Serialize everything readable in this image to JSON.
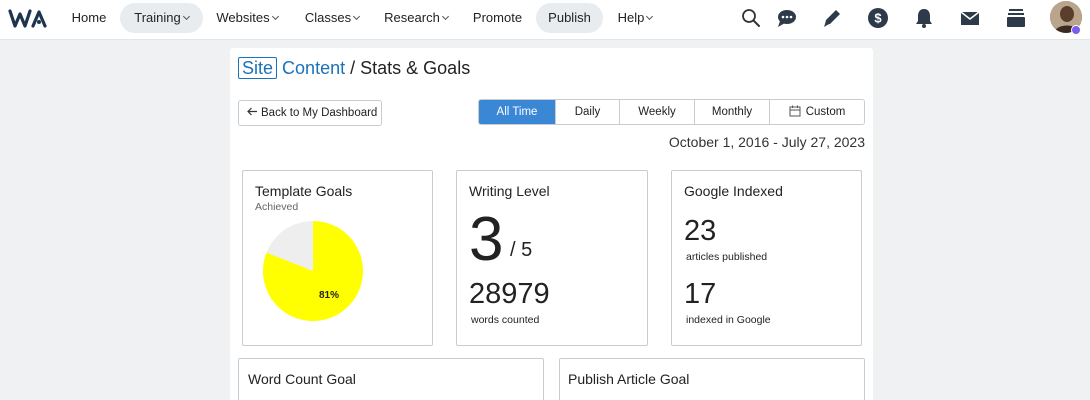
{
  "nav": {
    "items": [
      {
        "label": "Home",
        "dropdown": false,
        "active": false
      },
      {
        "label": "Training",
        "dropdown": true,
        "active": true
      },
      {
        "label": "Websites",
        "dropdown": true,
        "active": false
      },
      {
        "label": "Classes",
        "dropdown": true,
        "active": false
      },
      {
        "label": "Research",
        "dropdown": true,
        "active": false
      },
      {
        "label": "Promote",
        "dropdown": false,
        "active": false
      },
      {
        "label": "Publish",
        "dropdown": false,
        "active": true
      },
      {
        "label": "Help",
        "dropdown": true,
        "active": false
      }
    ],
    "icons": [
      "search-icon",
      "chat-icon",
      "pencil-icon",
      "dollar-icon",
      "bell-icon",
      "mail-icon",
      "inbox-icon"
    ]
  },
  "breadcrumb": {
    "site": "Site",
    "content": "Content",
    "separator": "/",
    "current": "Stats & Goals"
  },
  "back_button": "Back to My Dashboard",
  "ranges": [
    "All Time",
    "Daily",
    "Weekly",
    "Monthly",
    "Custom"
  ],
  "selected_range": "All Time",
  "date_range": "October 1, 2016 - July 27, 2023",
  "template_goals": {
    "title": "Template Goals",
    "subtitle": "Achieved",
    "percent_label": "81%",
    "achieved_fraction": 0.81,
    "achieved_color": "#ffff00",
    "remaining_color": "#eeeeee"
  },
  "writing_level": {
    "title": "Writing Level",
    "level": "3",
    "max": "/ 5",
    "words": "28979",
    "words_label": "words counted"
  },
  "google_indexed": {
    "title": "Google Indexed",
    "published": "23",
    "published_label": "articles published",
    "indexed": "17",
    "indexed_label": "indexed in Google"
  },
  "word_count_goal": {
    "title": "Word Count Goal"
  },
  "publish_article_goal": {
    "title": "Publish Article Goal"
  },
  "colors": {
    "accent": "#3a87d6",
    "link": "#1a72b9"
  }
}
